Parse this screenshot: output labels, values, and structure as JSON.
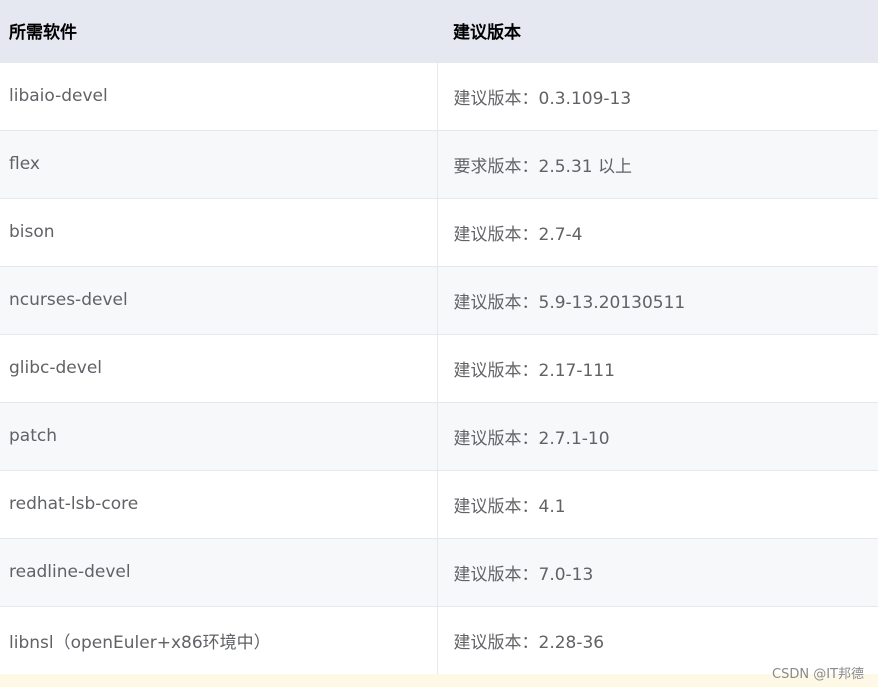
{
  "table": {
    "headers": [
      "所需软件",
      "建议版本"
    ],
    "rows": [
      {
        "software": "libaio-devel",
        "version": "建议版本：0.3.109-13"
      },
      {
        "software": "flex",
        "version": "要求版本：2.5.31 以上"
      },
      {
        "software": "bison",
        "version": "建议版本：2.7-4"
      },
      {
        "software": "ncurses-devel",
        "version": "建议版本：5.9-13.20130511"
      },
      {
        "software": "glibc-devel",
        "version": "建议版本：2.17-111"
      },
      {
        "software": "patch",
        "version": "建议版本：2.7.1-10"
      },
      {
        "software": "redhat-lsb-core",
        "version": "建议版本：4.1"
      },
      {
        "software": "readline-devel",
        "version": "建议版本：7.0-13"
      },
      {
        "software": "libnsl（openEuler+x86环境中）",
        "version": "建议版本：2.28-36"
      }
    ]
  },
  "watermark": "CSDN @IT邦德",
  "colors": {
    "header_bg": "#e5e8f1",
    "row_alt_bg": "#f7f8fa",
    "cell_text": "#606266",
    "bottom_strip": "#fdf9e6"
  }
}
